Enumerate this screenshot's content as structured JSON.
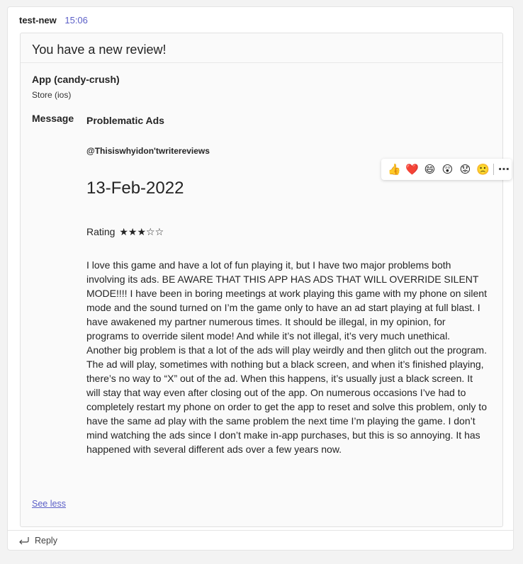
{
  "post": {
    "sender": "test-new",
    "time": "15:06"
  },
  "card": {
    "title": "You have a new review!",
    "app_name": "App (candy-crush)",
    "store": "Store (ios)",
    "message_label": "Message",
    "message_title": "Problematic Ads",
    "author": "@Thisiswhyidon'twritereviews",
    "date": "13-Feb-2022",
    "rating_label": "Rating",
    "rating_stars": "★★★☆☆",
    "rating_value": 3,
    "rating_max": 5,
    "review_text": "I love this game and have a lot of fun playing it, but I have two major problems both involving its ads. BE AWARE THAT THIS APP HAS ADS THAT WILL OVERRIDE SILENT MODE!!!! I have been in boring meetings at work playing this game with my phone on silent mode and the sound turned on I’m the game only to have an ad start playing at full blast. I have awakened my partner numerous times. It should be illegal, in my opinion, for programs to override silent mode! And while it’s not illegal, it’s very much unethical. Another big problem is that a lot of the ads will play weirdly and then glitch out the program. The ad will play, sometimes with nothing but a black screen, and when it’s finished playing, there’s no way to “X” out of the ad. When this happens, it’s usually just a black screen. It will stay that way even after closing out of the app. On numerous occasions I’ve had to completely restart my phone on order to get the app to reset and solve this problem, only to have the same ad play with the same problem the next time I’m playing the game. I don’t mind watching the ads since I don’t make in-app purchases, but this is so annoying. It has happened with several different ads over a few years now.",
    "see_less": "See less"
  },
  "reactions": {
    "items": [
      {
        "name": "like-icon",
        "glyph": "👍"
      },
      {
        "name": "heart-icon",
        "glyph": "❤️"
      },
      {
        "name": "laugh-icon",
        "glyph": "😄"
      },
      {
        "name": "surprised-icon",
        "glyph": "😲"
      },
      {
        "name": "sad-icon",
        "glyph": "😟"
      },
      {
        "name": "angry-icon",
        "glyph": "🙁"
      }
    ],
    "more": "⋯"
  },
  "reply": {
    "label": "Reply",
    "icon": "reply-arrow-icon"
  },
  "colors": {
    "accent": "#5b5fc7",
    "background": "#f3f3f3",
    "card_background": "#fafafa"
  }
}
